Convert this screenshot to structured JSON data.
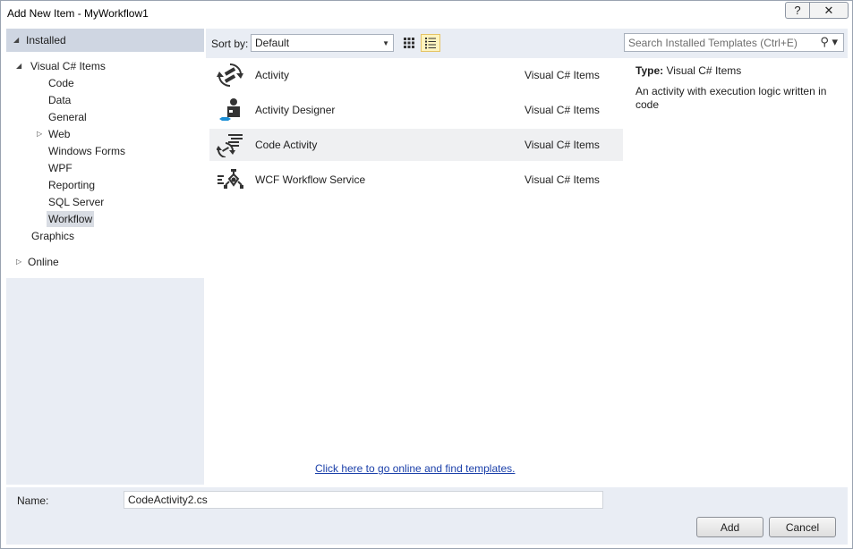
{
  "window": {
    "title": "Add New Item - MyWorkflow1",
    "help_label": "?",
    "close_label": "✕"
  },
  "tree": {
    "installed": "Installed",
    "visual_cs": "Visual C# Items",
    "children": [
      "Code",
      "Data",
      "General",
      "Web",
      "Windows Forms",
      "WPF",
      "Reporting",
      "SQL Server",
      "Workflow"
    ],
    "graphics": "Graphics",
    "online": "Online",
    "selected": "Workflow"
  },
  "toolbar": {
    "sort_label": "Sort by:",
    "sort_value": "Default",
    "search_placeholder": "Search Installed Templates (Ctrl+E)"
  },
  "templates": [
    {
      "name": "Activity",
      "category": "Visual C# Items",
      "icon": "activity-icon"
    },
    {
      "name": "Activity Designer",
      "category": "Visual C# Items",
      "icon": "activity-designer-icon"
    },
    {
      "name": "Code Activity",
      "category": "Visual C# Items",
      "icon": "code-activity-icon"
    },
    {
      "name": "WCF Workflow Service",
      "category": "Visual C# Items",
      "icon": "wcf-workflow-service-icon"
    }
  ],
  "online_link": "Click here to go online and find templates.",
  "details": {
    "type_label": "Type:",
    "type_value": "Visual C# Items",
    "description": "An activity with execution logic written in code"
  },
  "bottom": {
    "name_label": "Name:",
    "name_value": "CodeActivity2.cs",
    "add_label": "Add",
    "cancel_label": "Cancel"
  }
}
